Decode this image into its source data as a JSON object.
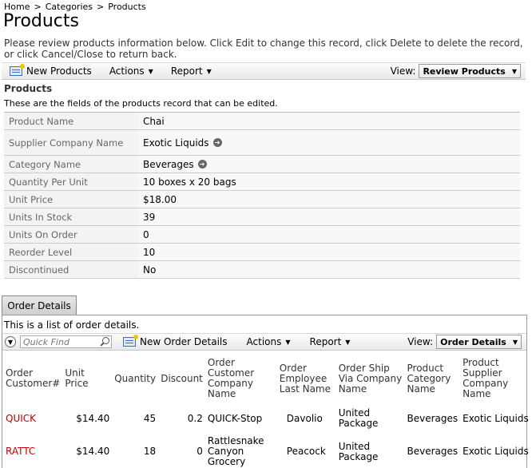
{
  "breadcrumb": {
    "items": [
      "Home",
      "Categories",
      "Products"
    ],
    "separator": ">"
  },
  "page": {
    "title": "Products",
    "intro": "Please review products information below. Click Edit to change this record, click Delete to delete the record, or click Cancel/Close to return back."
  },
  "toolbar1": {
    "new_label": "New Products",
    "actions_label": "Actions",
    "report_label": "Report",
    "view_label": "View:",
    "view_value": "Review Products"
  },
  "form": {
    "title": "Products",
    "description": "These are the fields of the products record that can be edited.",
    "fields": [
      {
        "label": "Product Name",
        "value": "Chai"
      },
      {
        "label": "Supplier Company Name",
        "value": "Exotic Liquids"
      },
      {
        "label": "Category Name",
        "value": "Beverages"
      },
      {
        "label": "Quantity Per Unit",
        "value": "10 boxes x 20 bags"
      },
      {
        "label": "Unit Price",
        "value": "$18.00"
      },
      {
        "label": "Units In Stock",
        "value": "39"
      },
      {
        "label": "Units On Order",
        "value": "0"
      },
      {
        "label": "Reorder Level",
        "value": "10"
      },
      {
        "label": "Discontinued",
        "value": "No"
      }
    ]
  },
  "tab": {
    "label": "Order Details",
    "description": "This is a list of order details."
  },
  "toolbar2": {
    "quick_find_placeholder": "Quick Find",
    "new_label": "New Order Details",
    "actions_label": "Actions",
    "report_label": "Report",
    "view_label": "View:",
    "view_value": "Order Details"
  },
  "grid": {
    "columns": [
      "Order Customer#",
      "Unit Price",
      "Quantity",
      "Discount",
      "Order Customer Company Name",
      "Order Employee Last Name",
      "Order Ship Via Company Name",
      "Product Category Name",
      "Product Supplier Company Name"
    ],
    "rows": [
      [
        "QUICK",
        "$14.40",
        "45",
        "0.2",
        "QUICK-Stop",
        "Davolio",
        "United Package",
        "Beverages",
        "Exotic Liquids"
      ],
      [
        "RATTC",
        "$14.40",
        "18",
        "0",
        "Rattlesnake Canyon Grocery",
        "Peacock",
        "United Package",
        "Beverages",
        "Exotic Liquids"
      ]
    ]
  },
  "colors": {
    "link_red": "#c00000",
    "toolbar_bg": "#eeeeee",
    "form_row_bg": "#f3f3f3"
  }
}
